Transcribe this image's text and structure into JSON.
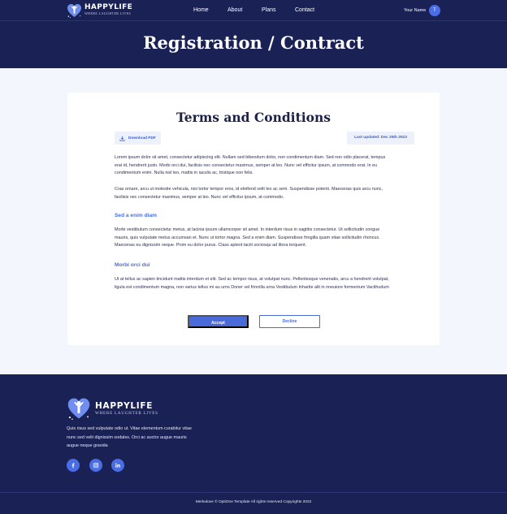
{
  "brand": {
    "name": "HAPPYLIFE",
    "tagline": "WHERE LAUGHTER LIVES"
  },
  "nav": {
    "items": [
      {
        "label": "Home"
      },
      {
        "label": "About"
      },
      {
        "label": "Plans"
      },
      {
        "label": "Contact"
      }
    ],
    "user_name": "Your Name",
    "avatar_initial": "T"
  },
  "hero": {
    "title": "Registration / Contract"
  },
  "terms": {
    "title": "Terms and Conditions",
    "download_label": "Download PDF",
    "last_updated": "Last updated: Dec 25th 2023",
    "paragraphs": [
      "Lorem ipsum dolor sit amet, consectetur adipiscing elit. Nullam sed bibendum dolor, non condimentum diam. Sed non odio placerat, tempus erat id, hendrerit justo. Morbi orci dui, facilisis nec consectetur maximus, semper at leo. Nunc vel efficitur ipsum, at commodo erat. In eu condimentum enim. Nulla nisl leo, mattis in iaculis ac, tristique non felis.",
      "Cras ornare, arcu ut molestie vehicula, nisi tortor tempor eros, id eleifend velit leo ac sem. Suspendisse potenti. Maecenas quis arcu nunc, facilisis nec consectetur maximus, semper at leo. Nunc vel efficitur ipsum, at commodo.",
      "Morbi vestibulum consectetur metus, at lacinia ipsum ullamcorper sit amet. In interdum risus in sagittis consectetur. Ut sollicitudin congue mauris, quis vulputate metus accumsan et. Nunc ut tortor magna. Sed a enim diam. Suspendisse fringilla quam vitae sollicitudin rhoncus. Maecenas eu dignissim neque. Proin eu dolor purus. Class aptent taciti sociosqu ad litora torquent.",
      "Ut at tellus ac sapien tincidunt mattis interdum et elit. Sed ac tempor risus, at volutpat nunc. Pellentesque venenatis, arcu a hendrerit volutpat, ligula est condimentum magna, non varius tellus mi au urns Doner vel frinnilla urna Vestibulum Inhartie alit in nneuiore formentum Vactihudum"
    ],
    "subheadings": [
      "Sed a enim diam",
      "Morbi orci dui"
    ],
    "accept_label": "Accept",
    "decline_label": "Decline"
  },
  "footer": {
    "description": "Quis risus sed vulputate odio ut. Vitae elementum curabitur vitae nunc sed velit dignissim sodales. Orci ac auctor augue mauris augue neque gravida",
    "social": [
      "facebook-icon",
      "instagram-icon",
      "linkedin-icon"
    ],
    "copyright": "Merkulove © OptiOne Template All rights reserved Copyrights 2022"
  },
  "colors": {
    "navy": "#192155",
    "accent": "#4a6de5",
    "page_bg": "#f3f6fc",
    "subhead": "#4b6ee0"
  }
}
